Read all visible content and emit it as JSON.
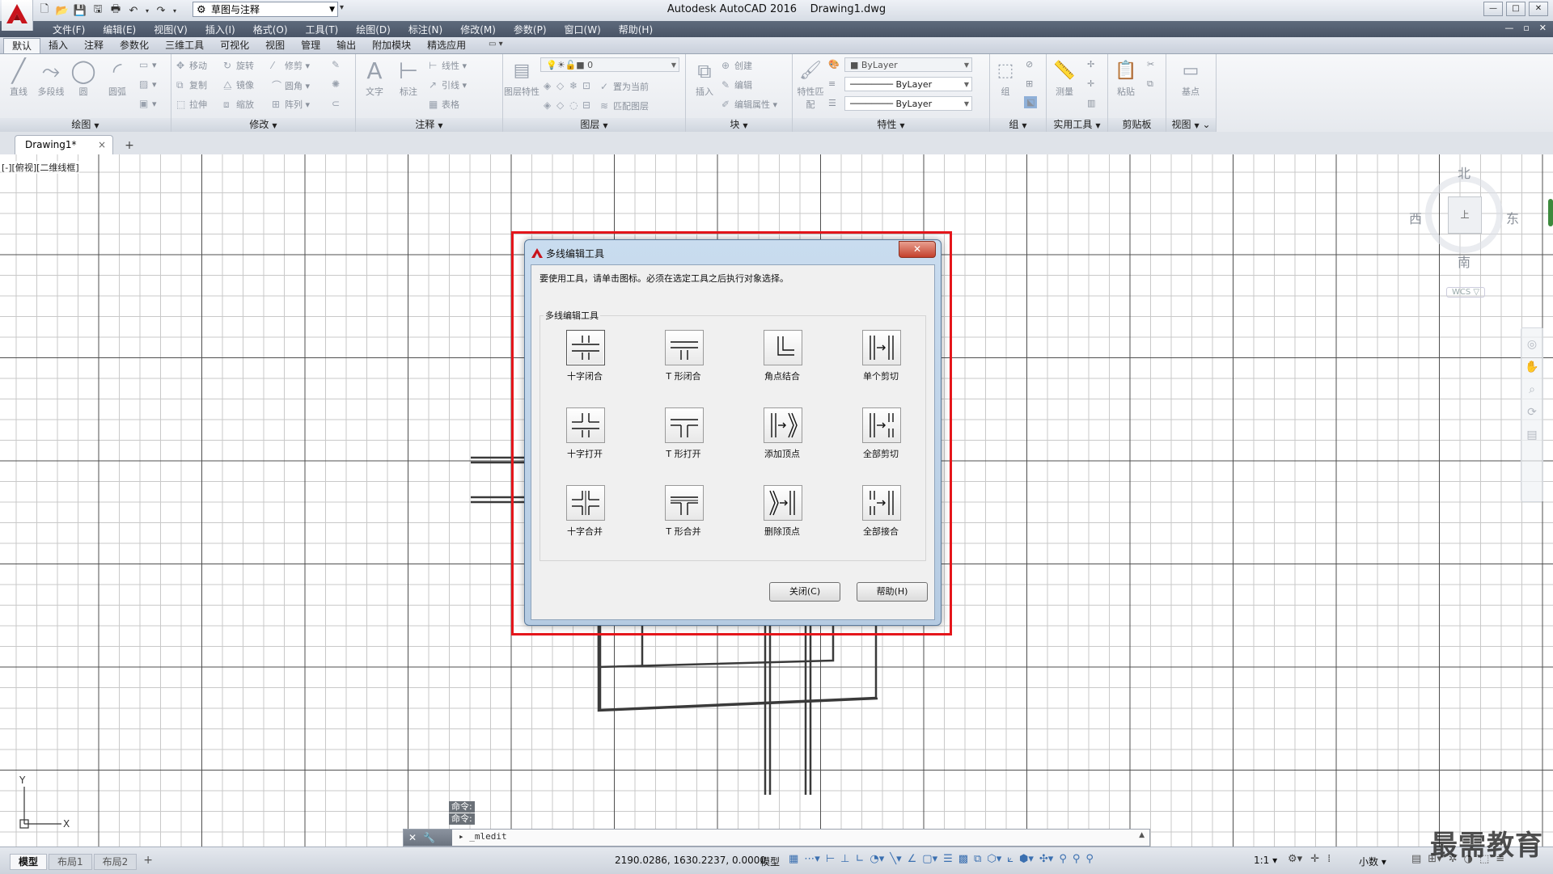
{
  "window": {
    "title": "Autodesk AutoCAD 2016    Drawing1.dwg",
    "workspace": "草图与注释",
    "controls": [
      "—",
      "□",
      "✕"
    ]
  },
  "menubar": {
    "items": [
      "文件(F)",
      "编辑(E)",
      "视图(V)",
      "插入(I)",
      "格式(O)",
      "工具(T)",
      "绘图(D)",
      "标注(N)",
      "修改(M)",
      "参数(P)",
      "窗口(W)",
      "帮助(H)"
    ],
    "mdi_controls": [
      "—",
      "▫",
      "✕"
    ]
  },
  "ribbon": {
    "tabs": [
      "默认",
      "插入",
      "注释",
      "参数化",
      "三维工具",
      "可视化",
      "视图",
      "管理",
      "输出",
      "附加模块",
      "精选应用"
    ],
    "active_tab": "默认",
    "panels": {
      "draw": {
        "label": "绘图",
        "tools": [
          "直线",
          "多段线",
          "圆",
          "圆弧"
        ]
      },
      "modify": {
        "label": "修改",
        "tools": [
          "移动",
          "旋转",
          "修剪",
          "复制",
          "镜像",
          "圆角",
          "拉伸",
          "缩放",
          "阵列"
        ]
      },
      "annotation": {
        "label": "注释",
        "tools": [
          "文字",
          "标注",
          "线性",
          "引线",
          "表格"
        ]
      },
      "layers": {
        "label": "图层",
        "tools": [
          "图层特性",
          "置为当前",
          "匹配图层"
        ],
        "current_layer": "0"
      },
      "block": {
        "label": "块",
        "tools": [
          "插入",
          "创建",
          "编辑",
          "编辑属性"
        ]
      },
      "properties": {
        "label": "特性",
        "tools": [
          "特性匹配"
        ],
        "color": "ByLayer",
        "linetype": "ByLayer",
        "lineweight": "ByLayer"
      },
      "groups": {
        "label": "组",
        "tools": [
          "组"
        ]
      },
      "utilities": {
        "label": "实用工具",
        "tools": [
          "测量"
        ]
      },
      "clipboard": {
        "label": "剪贴板",
        "tools": [
          "粘贴"
        ]
      },
      "view": {
        "label": "视图",
        "tools": [
          "基点"
        ]
      }
    }
  },
  "file_tabs": {
    "active": "Drawing1*",
    "close": "×",
    "add": "+"
  },
  "viewport": {
    "label": "[-][俯视][二维线框]",
    "viewcube": {
      "north": "北",
      "south": "南",
      "east": "东",
      "west": "西",
      "top": "上",
      "wcs": "WCS ▽"
    },
    "ucs": {
      "x": "X",
      "y": "Y"
    }
  },
  "dialog": {
    "title": "多线编辑工具",
    "close_glyph": "✕",
    "instruction": "要使用工具，请单击图标。必须在选定工具之后执行对象选择。",
    "group_label": "多线编辑工具",
    "tools": [
      {
        "label": "十字闭合",
        "icon": "closed-cross-icon"
      },
      {
        "label": "T 形闭合",
        "icon": "closed-tee-icon"
      },
      {
        "label": "角点结合",
        "icon": "corner-joint-icon"
      },
      {
        "label": "单个剪切",
        "icon": "cut-single-icon"
      },
      {
        "label": "十字打开",
        "icon": "open-cross-icon"
      },
      {
        "label": "T 形打开",
        "icon": "open-tee-icon"
      },
      {
        "label": "添加顶点",
        "icon": "add-vertex-icon"
      },
      {
        "label": "全部剪切",
        "icon": "cut-all-icon"
      },
      {
        "label": "十字合并",
        "icon": "merged-cross-icon"
      },
      {
        "label": "T 形合并",
        "icon": "merged-tee-icon"
      },
      {
        "label": "删除顶点",
        "icon": "delete-vertex-icon"
      },
      {
        "label": "全部接合",
        "icon": "weld-all-icon"
      }
    ],
    "close_button": "关闭(C)",
    "help_button": "帮助(H)",
    "highlight_color": "#e5161b"
  },
  "command": {
    "history": [
      "命令:",
      "命令:"
    ],
    "current": "_mledit"
  },
  "statusbar": {
    "layout_tabs": [
      "模型",
      "布局1",
      "布局2"
    ],
    "active_layout": "模型",
    "add_layout": "+",
    "coordinates": "2190.0286, 1630.2237, 0.0000",
    "model": "模型",
    "scale": "1:1 ▾",
    "units": "小数"
  },
  "watermark": "最需教育"
}
